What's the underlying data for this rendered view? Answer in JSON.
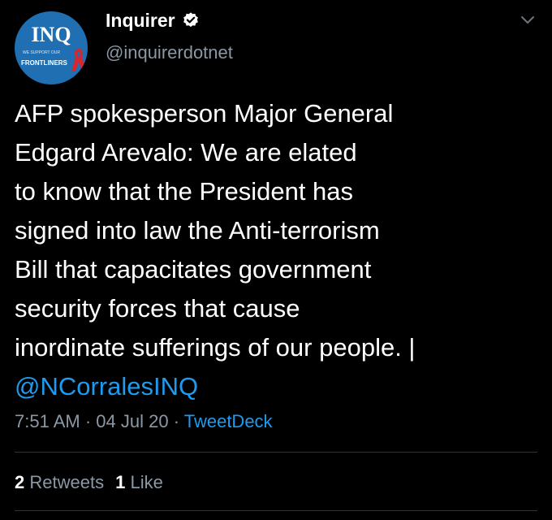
{
  "account": {
    "display_name": "Inquirer",
    "handle": "@inquirerdotnet",
    "avatar_brand": "INQ",
    "avatar_sub": "WE SUPPORT OUR",
    "avatar_sub2": "FRONTLINERS",
    "verified": true
  },
  "tweet": {
    "text": "AFP spokesperson Major General\nEdgard Arevalo: We are elated\nto know that the President has\nsigned into law the Anti-terrorism\nBill that capacitates government\nsecurity forces that cause\ninordinate sufferings of our people. |",
    "mention": "@NCorralesINQ"
  },
  "meta": {
    "time": "7:51 AM",
    "sep1": " · ",
    "date": "04 Jul 20",
    "sep2": " · ",
    "source": "TweetDeck"
  },
  "stats": {
    "retweets_count": "2",
    "retweets_label": "Retweets",
    "likes_count": "1",
    "likes_label": "Like"
  },
  "colors": {
    "background": "#000000",
    "text": "#ffffff",
    "secondary": "#8b98a5",
    "link": "#1d9bf0",
    "avatar": "#1f6fb2"
  }
}
